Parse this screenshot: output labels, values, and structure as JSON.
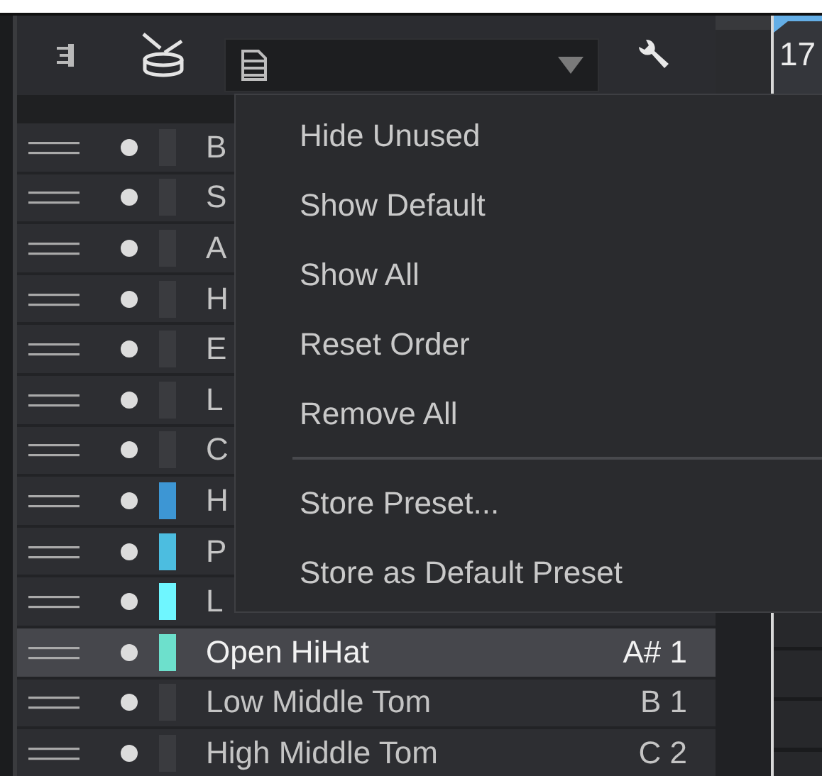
{
  "timeline": {
    "bar_number": "17"
  },
  "rows": [
    {
      "name": "B",
      "color": "#3a3b3f",
      "selected": false
    },
    {
      "name": "S",
      "color": "#3a3b3f",
      "selected": false
    },
    {
      "name": "A",
      "color": "#3a3b3f",
      "selected": false
    },
    {
      "name": "H",
      "color": "#3a3b3f",
      "selected": false
    },
    {
      "name": "E",
      "color": "#3a3b3f",
      "selected": false
    },
    {
      "name": "L",
      "color": "#3a3b3f",
      "selected": false
    },
    {
      "name": "C",
      "color": "#3a3b3f",
      "selected": false
    },
    {
      "name": "H",
      "color": "#3d96d4",
      "selected": false
    },
    {
      "name": "P",
      "color": "#4cbde0",
      "selected": false
    },
    {
      "name": "L",
      "color": "#6ff6ff",
      "selected": false
    },
    {
      "name": "Open HiHat",
      "note": "A# 1",
      "color": "#6de0cc",
      "selected": true
    },
    {
      "name": "Low Middle Tom",
      "note": "B 1",
      "color": "#3a3b3f",
      "selected": false
    },
    {
      "name": "High Middle Tom",
      "note": "C 2",
      "color": "#3a3b3f",
      "selected": false
    }
  ],
  "menu": {
    "items": [
      {
        "kind": "item",
        "label": "Hide Unused"
      },
      {
        "kind": "item",
        "label": "Show Default"
      },
      {
        "kind": "item",
        "label": "Show All"
      },
      {
        "kind": "item",
        "label": "Reset Order"
      },
      {
        "kind": "item",
        "label": "Remove All"
      },
      {
        "kind": "separator"
      },
      {
        "kind": "item",
        "label": "Store Preset..."
      },
      {
        "kind": "item",
        "label": "Store as Default Preset"
      }
    ]
  }
}
